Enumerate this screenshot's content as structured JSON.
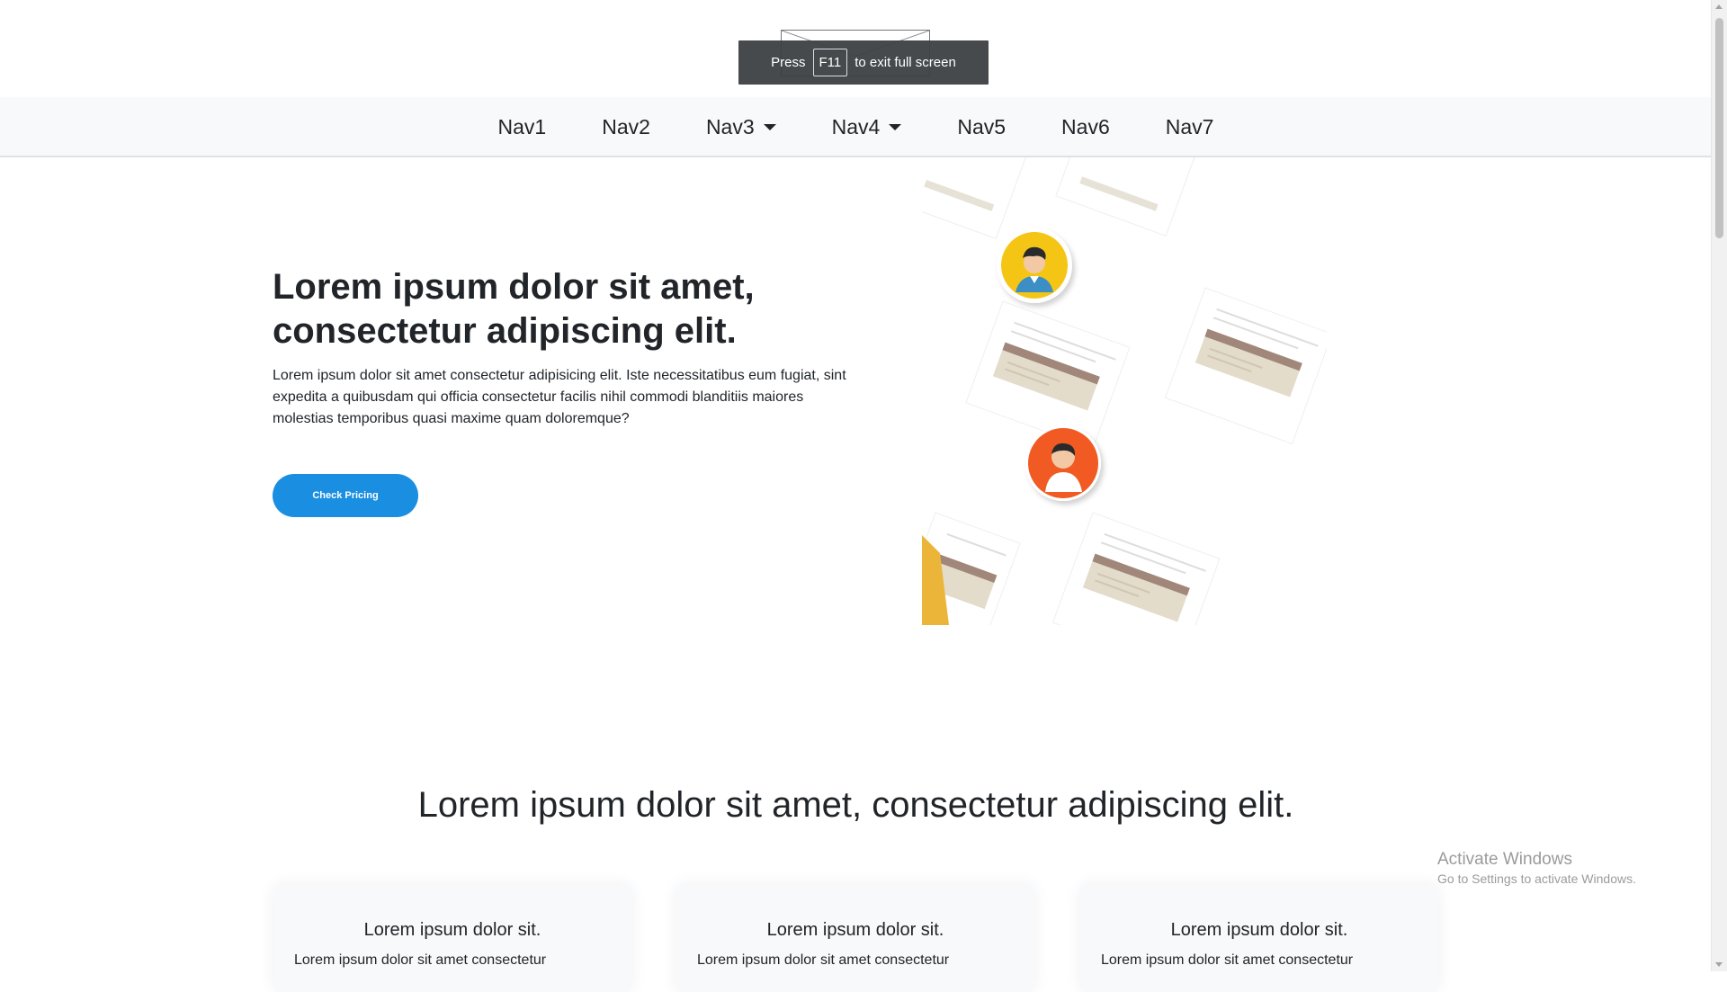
{
  "fullscreen_toast": {
    "press": "Press",
    "key": "F11",
    "message": "to exit full screen"
  },
  "nav": {
    "items": [
      {
        "label": "Nav1",
        "dropdown": false
      },
      {
        "label": "Nav2",
        "dropdown": false
      },
      {
        "label": "Nav3",
        "dropdown": true
      },
      {
        "label": "Nav4",
        "dropdown": true
      },
      {
        "label": "Nav5",
        "dropdown": false
      },
      {
        "label": "Nav6",
        "dropdown": false
      },
      {
        "label": "Nav7",
        "dropdown": false
      }
    ]
  },
  "hero": {
    "title_line1": "Lorem ipsum dolor sit amet,",
    "title_line2": "consectetur adipiscing elit.",
    "description": "Lorem ipsum dolor sit amet consectetur adipisicing elit. Iste necessitatibus eum fugiat, sint expedita a quibusdam qui officia consectetur facilis nihil commodi blanditiis maiores molestias temporibus quasi maxime quam doloremque?",
    "cta_label": "Check Pricing"
  },
  "section": {
    "title": "Lorem ipsum dolor sit amet, consectetur adipiscing elit.",
    "cards": [
      {
        "title": "Lorem ipsum dolor sit.",
        "text": "Lorem ipsum dolor sit amet consectetur"
      },
      {
        "title": "Lorem ipsum dolor sit.",
        "text": "Lorem ipsum dolor sit amet consectetur"
      },
      {
        "title": "Lorem ipsum dolor sit.",
        "text": "Lorem ipsum dolor sit amet consectetur"
      }
    ]
  },
  "watermark": {
    "title": "Activate Windows",
    "subtitle": "Go to Settings to activate Windows."
  },
  "colors": {
    "accent": "#1a8ee1",
    "navbar_bg": "#f8f9fa",
    "avatar_yellow": "#f5c518",
    "avatar_orange": "#f15a22"
  }
}
